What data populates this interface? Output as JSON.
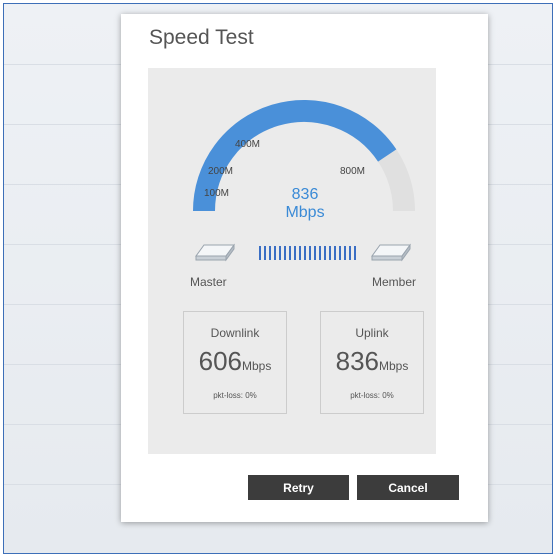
{
  "dialog": {
    "title": "Speed Test",
    "gauge": {
      "speed_value": "836",
      "speed_unit": "Mbps",
      "speed_mbps": 836,
      "scale_labels": [
        "100M",
        "200M",
        "400M",
        "800M"
      ],
      "fill_color": "#4a90d9",
      "track_color": "#e0e0e0"
    },
    "devices": {
      "left_label": "Master",
      "right_label": "Member"
    },
    "downlink": {
      "label": "Downlink",
      "value": "606",
      "unit": "Mbps",
      "loss": "pkt-loss: 0%"
    },
    "uplink": {
      "label": "Uplink",
      "value": "836",
      "unit": "Mbps",
      "loss": "pkt-loss: 0%"
    },
    "buttons": {
      "retry": "Retry",
      "cancel": "Cancel"
    }
  }
}
